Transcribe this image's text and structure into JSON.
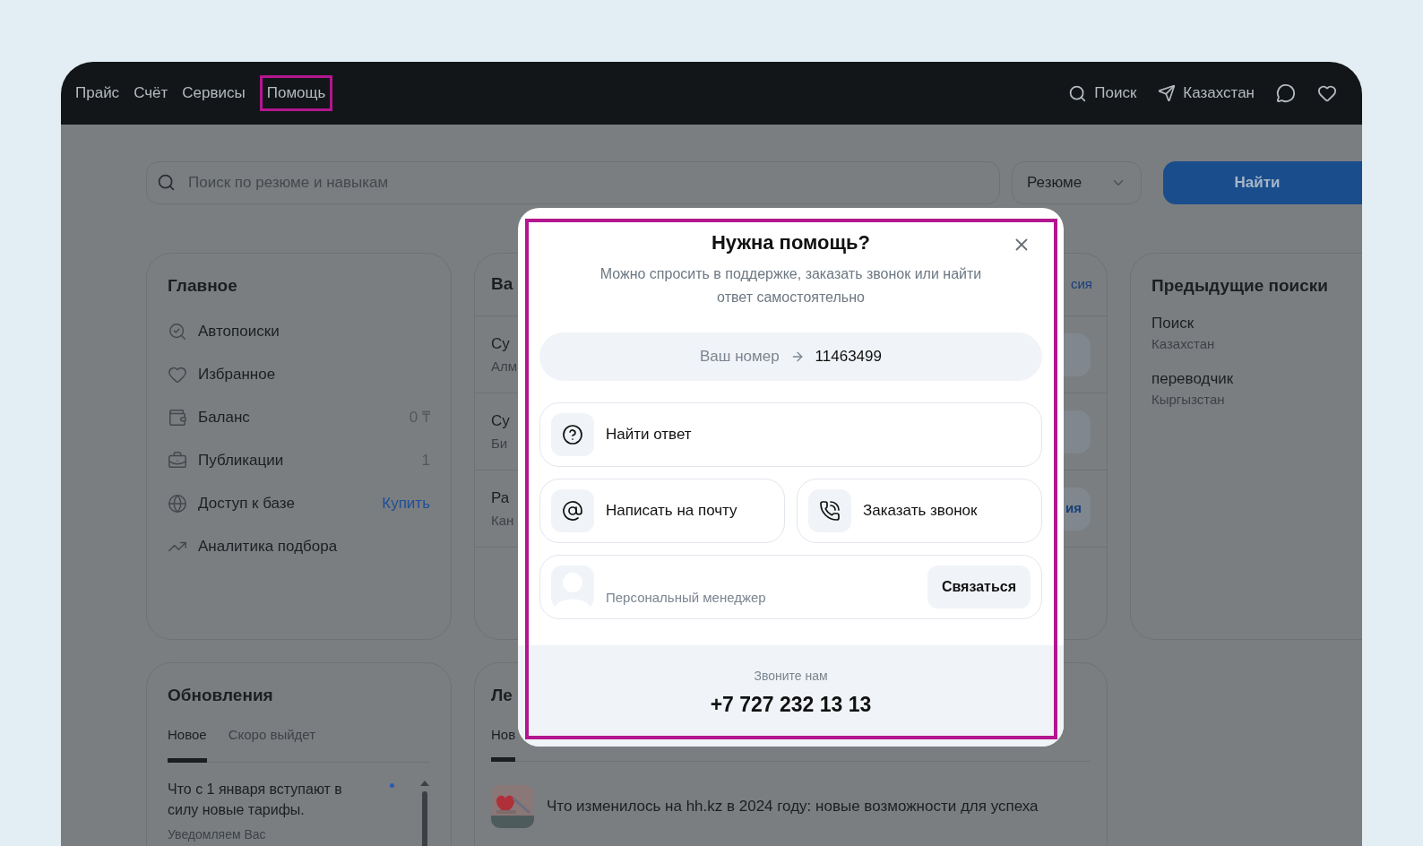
{
  "nav": {
    "links": [
      {
        "label": "Прайс",
        "selected": false
      },
      {
        "label": "Счёт",
        "selected": false
      },
      {
        "label": "Сервисы",
        "selected": false
      },
      {
        "label": "Помощь",
        "selected": true
      }
    ],
    "search_label": "Поиск",
    "region": "Казахстан"
  },
  "search": {
    "placeholder": "Поиск по резюме и навыкам",
    "type_select": "Резюме",
    "submit": "Найти"
  },
  "main_card": {
    "title": "Главное",
    "items": [
      {
        "kind": "autosearch",
        "label": "Автопоиски"
      },
      {
        "kind": "favorite",
        "label": "Избранное"
      },
      {
        "kind": "wallet",
        "label": "Баланс",
        "value": "0 ₸"
      },
      {
        "kind": "briefcase",
        "label": "Публикации",
        "value": "1"
      },
      {
        "kind": "globe",
        "label": "Доступ к базе",
        "action": "Купить"
      },
      {
        "kind": "analytics",
        "label": "Аналитика подбора"
      }
    ]
  },
  "vacancies_card": {
    "title": "Ва",
    "link": "сия",
    "rows": [
      {
        "title": "Су",
        "subtitle": "Алм"
      },
      {
        "title": "Су",
        "subtitle": "Би"
      },
      {
        "title": "Ра",
        "subtitle": "Кан",
        "action": "ия"
      }
    ]
  },
  "previous_searches": {
    "title": "Предыдущие поиски",
    "items": [
      {
        "query": "Поиск",
        "region": "Казахстан"
      },
      {
        "query": "переводчик",
        "region": "Кыргызстан"
      }
    ]
  },
  "updates_card": {
    "title": "Обновления",
    "tabs": [
      {
        "label": "Новое",
        "selected": true
      },
      {
        "label": "Скоро выйдет",
        "selected": false
      }
    ],
    "items": [
      {
        "title": "Что с 1 января вступают в силу новые тарифы.",
        "subtitle": "Уведомляем Вас",
        "unread": true
      }
    ]
  },
  "news_card": {
    "title": "Ле",
    "tabs": [
      {
        "label": "Нов",
        "selected": true
      }
    ],
    "items": [
      {
        "kind": "picture",
        "text": "Что изменилось на hh.kz в 2024 году: новые возможности для успеха"
      }
    ]
  },
  "modal": {
    "title": "Нужна помощь?",
    "subtitle": "Можно спросить в поддержке, заказать звонок или найти ответ самостоятельно",
    "number_label": "Ваш номер",
    "number": "11463499",
    "options": [
      {
        "kind": "help",
        "label": "Найти ответ"
      },
      {
        "kind": "email",
        "label": "Написать на почту"
      },
      {
        "kind": "call",
        "label": "Заказать звонок"
      }
    ],
    "manager": {
      "label": "Персональный менеджер",
      "action": "Связаться"
    },
    "footer": {
      "label": "Звоните нам",
      "phone": "+7 727 232 13 13"
    }
  }
}
